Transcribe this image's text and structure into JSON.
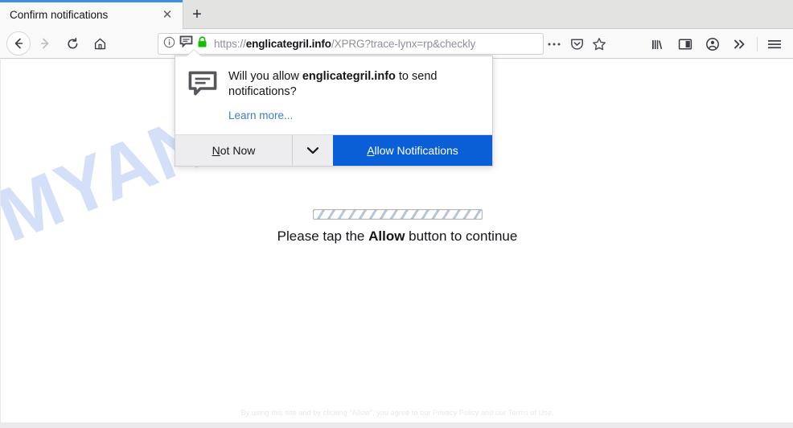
{
  "browser": {
    "tab": {
      "title": "Confirm notifications",
      "close_label": "✕",
      "newtab_label": "+"
    },
    "nav": {
      "back_label": "Back",
      "forward_label": "Forward",
      "reload_label": "Reload",
      "home_label": "Home"
    },
    "urlbar": {
      "scheme": "https://",
      "domain": "englicategril.info",
      "path": "/XPRG?trace-lynx=rp&checkly",
      "full_url": "https://englicategril.info/XPRG?trace-lynx=rp&checkly",
      "identity_info_icon": "info-circle-icon",
      "notification_icon": "notification-bubble-icon",
      "lock_icon": "padlock-icon",
      "lock_color": "#12bc00",
      "page_actions_icon": "ellipsis-icon",
      "pocket_icon": "pocket-icon",
      "bookmark_icon": "star-icon"
    },
    "toolbar": {
      "library_icon": "library-icon",
      "sidebar_icon": "sidebar-icon",
      "account_icon": "account-icon",
      "overflow_icon": "double-chevron-icon",
      "menu_icon": "hamburger-menu-icon"
    }
  },
  "popup": {
    "icon": "notification-bubble-icon",
    "question_prefix": "Will you allow ",
    "question_domain": "englicategril.info",
    "question_suffix": " to send notifications?",
    "learn_more": "Learn more...",
    "not_now_accesskey": "N",
    "not_now_rest": "ot Now",
    "chevron_icon": "chevron-down-icon",
    "allow_accesskey": "A",
    "allow_rest": "llow Notifications",
    "allow_button_color": "#0a5fd6"
  },
  "page": {
    "watermark": "MYANTISPYWARE.COM",
    "watermark_color": "#d3e0f7",
    "progress_label": "loading-progress-bar",
    "tap_prefix": "Please tap the ",
    "tap_bold": "Allow",
    "tap_suffix": " button to continue",
    "footer": "By using this site and by clicking \"Allow\", you agree to our Privacy Policy and our Terms of Use."
  }
}
